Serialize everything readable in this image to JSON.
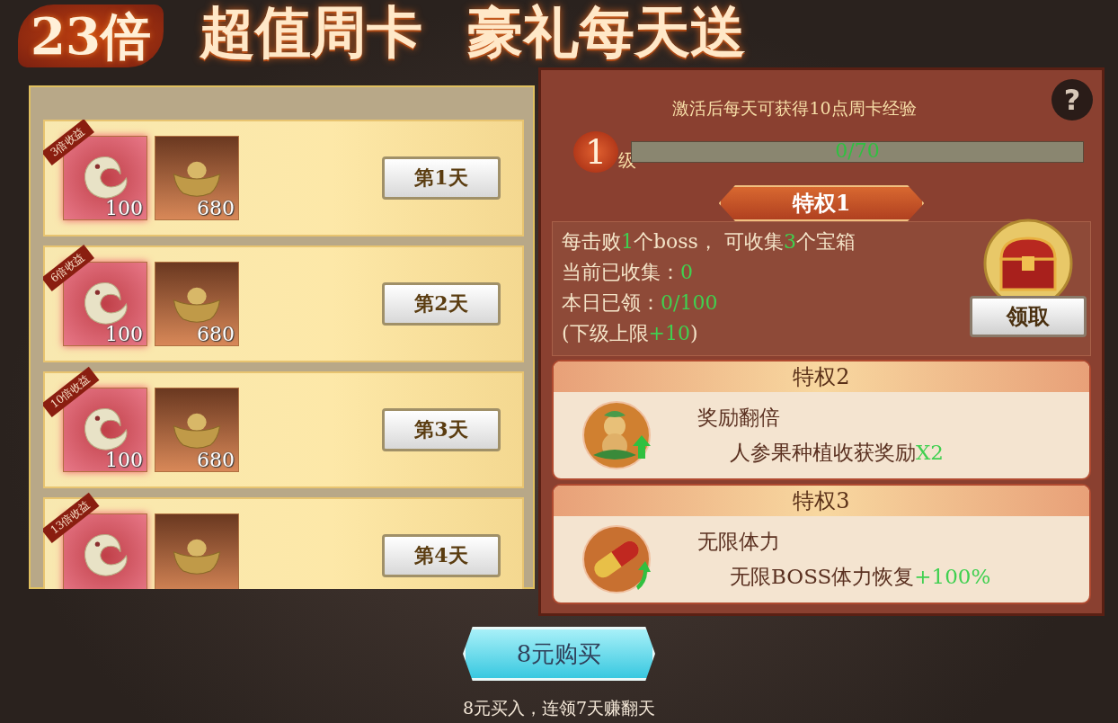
{
  "banner": {
    "multiplier": "23倍",
    "title": "超值周卡",
    "slogan": "豪礼每天送"
  },
  "days": [
    {
      "badge": "3倍收益",
      "items": [
        {
          "kind": "jade",
          "amount": "100"
        },
        {
          "kind": "ingot",
          "amount": "680"
        }
      ],
      "button": "第1天"
    },
    {
      "badge": "6倍收益",
      "items": [
        {
          "kind": "jade",
          "amount": "100"
        },
        {
          "kind": "ingot",
          "amount": "680"
        }
      ],
      "button": "第2天"
    },
    {
      "badge": "10倍收益",
      "items": [
        {
          "kind": "jade",
          "amount": "100"
        },
        {
          "kind": "ingot",
          "amount": "680"
        }
      ],
      "button": "第3天"
    },
    {
      "badge": "13倍收益",
      "items": [
        {
          "kind": "jade"
        },
        {
          "kind": "ingot"
        }
      ],
      "button": "第4天"
    }
  ],
  "card": {
    "help": "?",
    "subtitle": "激活后每天可获得10点周卡经验",
    "rank": "1",
    "rank_unit": "级",
    "progress": {
      "level": 0,
      "reading": "0/70"
    },
    "main_privilege": {
      "title": "特权1",
      "claim": "领取",
      "lines": [
        [
          {
            "text": "每击败",
            "highlight": false
          },
          {
            "text": "1",
            "highlight": true
          },
          {
            "text": "个boss， 可收集",
            "highlight": false
          },
          {
            "text": "3",
            "highlight": true
          },
          {
            "text": "个宝箱",
            "highlight": false
          }
        ],
        [
          {
            "text": "当前已收集：",
            "highlight": false
          },
          {
            "text": "0",
            "highlight": true
          }
        ],
        [
          {
            "text": "本日已领：",
            "highlight": false
          },
          {
            "text": "0/100",
            "highlight": true
          }
        ],
        [
          {
            "text": "(下级上限",
            "highlight": false
          },
          {
            "text": "+10",
            "highlight": true
          },
          {
            "text": ")",
            "highlight": false
          }
        ]
      ]
    },
    "privileges": [
      {
        "title": "特权2",
        "kind": "doll",
        "name": "奖励翻倍",
        "description": [
          {
            "text": "人参果种植收获奖励",
            "highlight": false
          },
          {
            "text": "X2",
            "highlight": true
          }
        ]
      },
      {
        "title": "特权3",
        "kind": "pill",
        "name": "无限体力",
        "description": [
          {
            "text": "无限BOSS体力恢复",
            "highlight": false
          },
          {
            "text": "+100%",
            "highlight": true
          }
        ]
      }
    ]
  },
  "buy": {
    "label": "8元购买",
    "caption": "8元买入，连领7天赚翻天"
  }
}
